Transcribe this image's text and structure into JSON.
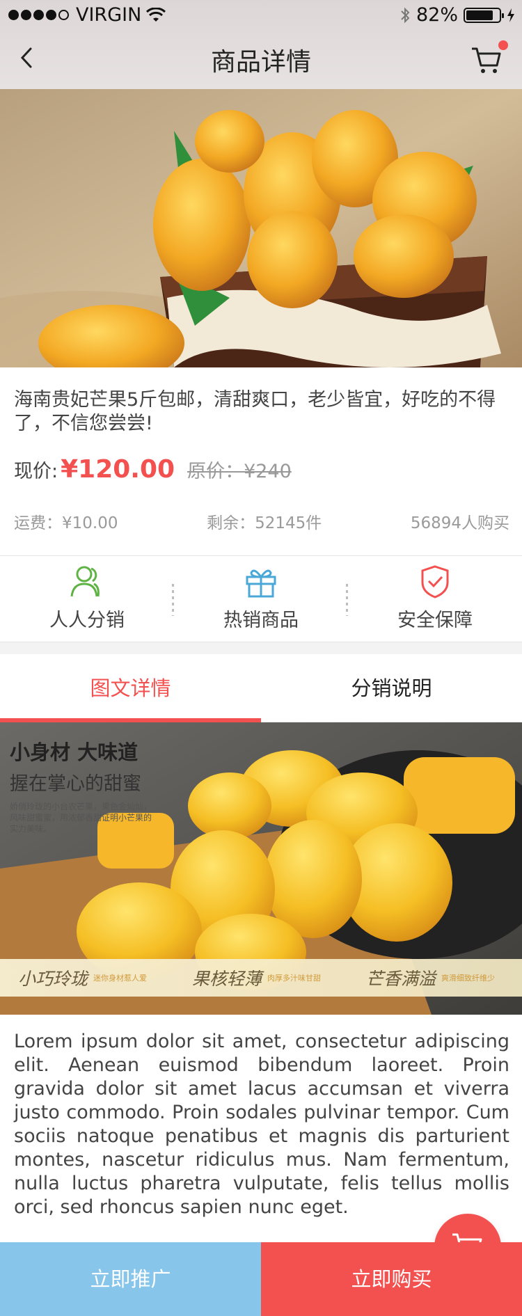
{
  "status_bar": {
    "carrier": "VIRGIN",
    "battery": "82%",
    "battery_level": 0.82
  },
  "nav": {
    "title": "商品详情"
  },
  "product": {
    "description": "海南贵妃芒果5斤包邮，清甜爽口，老少皆宜，好吃的不得了，不信您尝尝!",
    "price_label": "现价:",
    "price": "¥120.00",
    "original_price": "原价：¥240",
    "shipping": "运费：¥10.00",
    "stock": "剩余：52145件",
    "buyers": "56894人购买"
  },
  "features": [
    {
      "label": "人人分销",
      "icon": "people-icon"
    },
    {
      "label": "热销商品",
      "icon": "gift-icon"
    },
    {
      "label": "安全保障",
      "icon": "shield-icon"
    }
  ],
  "tabs": [
    {
      "label": "图文详情",
      "active": true
    },
    {
      "label": "分销说明",
      "active": false
    }
  ],
  "promo": {
    "headline": "小身材 大味道",
    "subheadline": "握在掌心的甜蜜",
    "blurb": "娇俏玲珑的小台农芒果，果色金灿灿，风味甜蜜蜜，用浓郁香甜证明小芒果的实力美味。",
    "band": [
      {
        "title": "小巧玲珑",
        "caption": "迷你身材惹人爱"
      },
      {
        "title": "果核轻薄",
        "caption": "肉厚多汁味甘甜"
      },
      {
        "title": "芒香满溢",
        "caption": "爽滑细致纤维少"
      }
    ]
  },
  "body_text": "Lorem ipsum dolor sit amet, consectetur adipiscing elit. Aenean euismod bibendum laoreet. Proin gravida dolor sit amet lacus accumsan et viverra justo commodo. Proin sodales pulvinar tempor. Cum sociis natoque penatibus et magnis dis parturient montes, nascetur ridiculus mus. Nam fermentum, nulla luctus pharetra vulputate, felis tellus mollis orci, sed rhoncus sapien nunc eget.",
  "actions": {
    "promote": "立即推广",
    "buy": "立即购买"
  },
  "colors": {
    "accent": "#f3514f",
    "promote": "#87c6ea",
    "green": "#5fb345",
    "blue": "#4aa8d8"
  }
}
